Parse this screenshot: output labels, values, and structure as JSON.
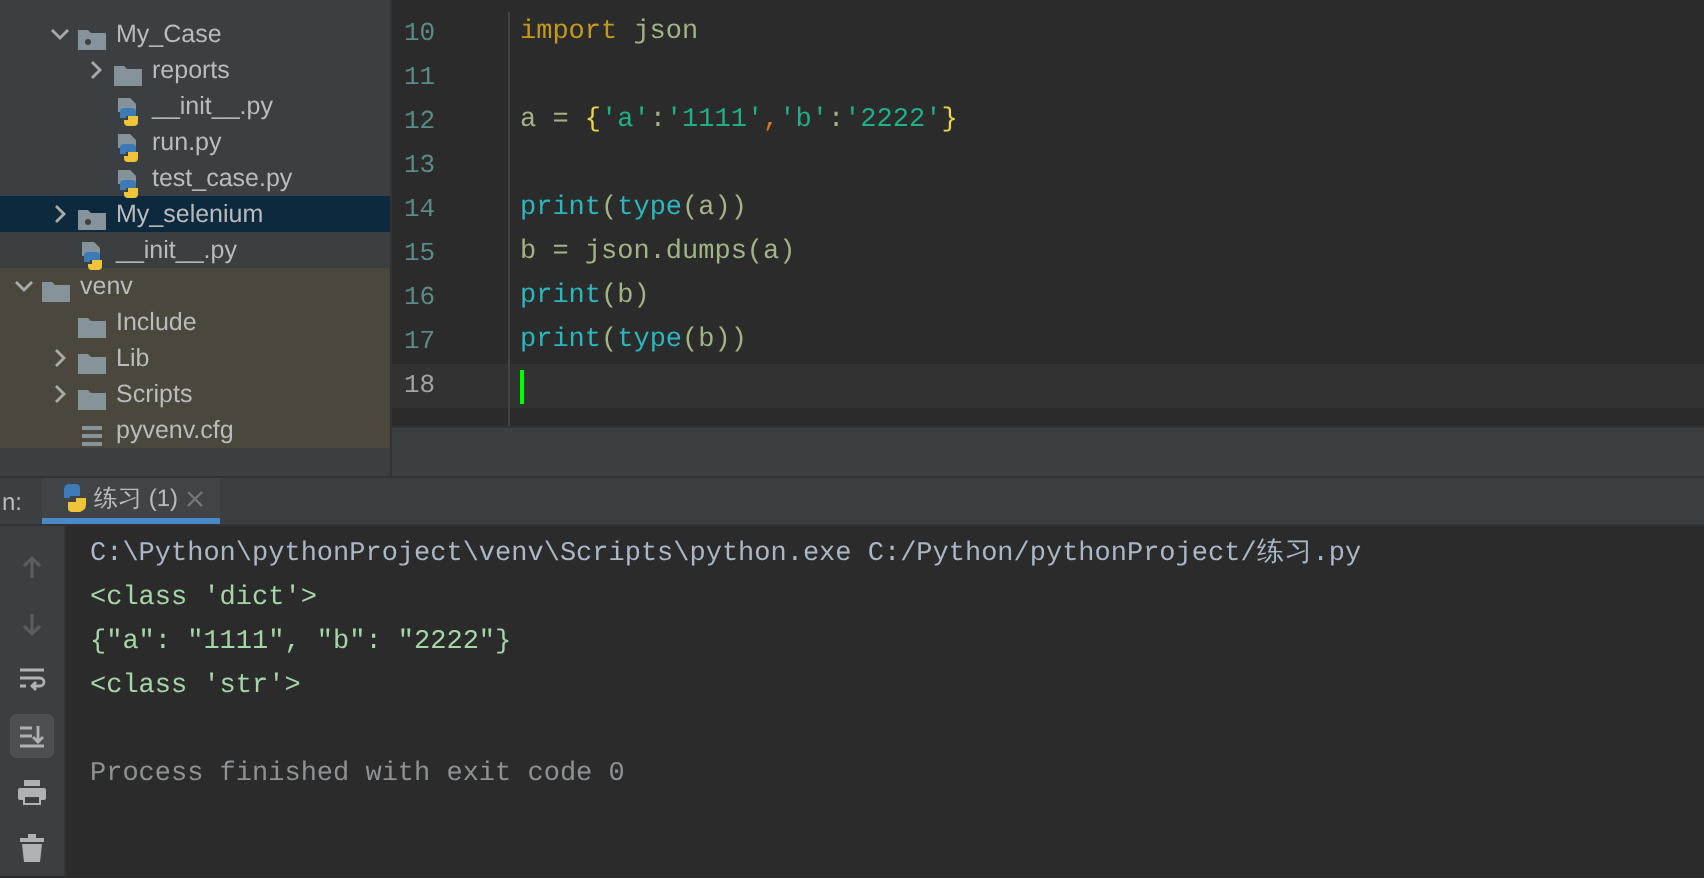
{
  "project_tree": {
    "items": [
      {
        "kind": "hidden",
        "children": [
          {
            "kind": "package",
            "label": "My_Case",
            "expanded": true,
            "selected": false,
            "children": [
              {
                "kind": "folder",
                "label": "reports",
                "expanded": false,
                "selected": false
              },
              {
                "kind": "python",
                "label": "__init__.py",
                "selected": false
              },
              {
                "kind": "python",
                "label": "run.py",
                "selected": false
              },
              {
                "kind": "python",
                "label": "test_case.py",
                "selected": false
              }
            ]
          },
          {
            "kind": "package",
            "label": "My_selenium",
            "expanded": false,
            "selected": true
          },
          {
            "kind": "python",
            "label": "__init__.py",
            "selected": false
          }
        ]
      },
      {
        "kind": "folder",
        "label": "venv",
        "expanded": true,
        "excluded": true,
        "selected": false,
        "children": [
          {
            "kind": "folder",
            "label": "Include",
            "selected": false
          },
          {
            "kind": "folder",
            "label": "Lib",
            "expanded": false,
            "selected": false
          },
          {
            "kind": "folder",
            "label": "Scripts",
            "expanded": false,
            "selected": false
          },
          {
            "kind": "file",
            "label": "pyvenv.cfg",
            "selected": false
          }
        ]
      }
    ]
  },
  "editor": {
    "lines": [
      {
        "number": "10",
        "current": false,
        "tokens": [
          {
            "kind": "keyword",
            "text": "import"
          },
          {
            "kind": "plain",
            "text": " json"
          }
        ]
      },
      {
        "number": "11",
        "current": false
      },
      {
        "number": "12",
        "current": false,
        "tokens": [
          {
            "kind": "plain",
            "text": "a = "
          },
          {
            "kind": "brace",
            "text": "{"
          },
          {
            "kind": "string",
            "text": "'a'"
          },
          {
            "kind": "plain",
            "text": ":"
          },
          {
            "kind": "string",
            "text": "'1111'"
          },
          {
            "kind": "comma",
            "text": ","
          },
          {
            "kind": "string",
            "text": "'b'"
          },
          {
            "kind": "plain",
            "text": ":"
          },
          {
            "kind": "string",
            "text": "'2222'"
          },
          {
            "kind": "brace",
            "text": "}"
          }
        ]
      },
      {
        "number": "13",
        "current": false
      },
      {
        "number": "14",
        "current": false,
        "tokens": [
          {
            "kind": "builtin",
            "text": "print"
          },
          {
            "kind": "plain",
            "text": "("
          },
          {
            "kind": "builtin",
            "text": "type"
          },
          {
            "kind": "plain",
            "text": "(a))"
          }
        ]
      },
      {
        "number": "15",
        "current": false,
        "tokens": [
          {
            "kind": "plain",
            "text": "b = json.dumps(a)"
          }
        ]
      },
      {
        "number": "16",
        "current": false,
        "tokens": [
          {
            "kind": "builtin",
            "text": "print"
          },
          {
            "kind": "plain",
            "text": "(b)"
          }
        ]
      },
      {
        "number": "17",
        "current": false,
        "tokens": [
          {
            "kind": "builtin",
            "text": "print"
          },
          {
            "kind": "plain",
            "text": "("
          },
          {
            "kind": "builtin",
            "text": "type"
          },
          {
            "kind": "plain",
            "text": "(b))"
          }
        ]
      },
      {
        "number": "18",
        "current": true
      }
    ]
  },
  "run_panel": {
    "label": "n:",
    "tabs": [
      {
        "label": "练习 (1)",
        "selected": true
      }
    ],
    "toolbar": [
      {
        "kind": "up",
        "selected": false,
        "disabled": true
      },
      {
        "kind": "down",
        "selected": false,
        "disabled": true
      },
      {
        "kind": "wrap",
        "selected": false,
        "disabled": false
      },
      {
        "kind": "scroll-end",
        "selected": true,
        "disabled": false
      },
      {
        "kind": "print",
        "selected": false,
        "disabled": false
      },
      {
        "kind": "trash",
        "selected": false,
        "disabled": false
      }
    ],
    "console": [
      {
        "kind": "command",
        "text": "C:\\Python\\pythonProject\\venv\\Scripts\\python.exe C:/Python/pythonProject/练习.py"
      },
      {
        "kind": "output",
        "text": "<class 'dict'>"
      },
      {
        "kind": "output",
        "text": "{\"a\": \"1111\", \"b\": \"2222\"}"
      },
      {
        "kind": "output",
        "text": "<class 'str'>"
      },
      {
        "kind": "blank"
      },
      {
        "kind": "exit",
        "text": "Process finished with exit code 0"
      }
    ]
  }
}
